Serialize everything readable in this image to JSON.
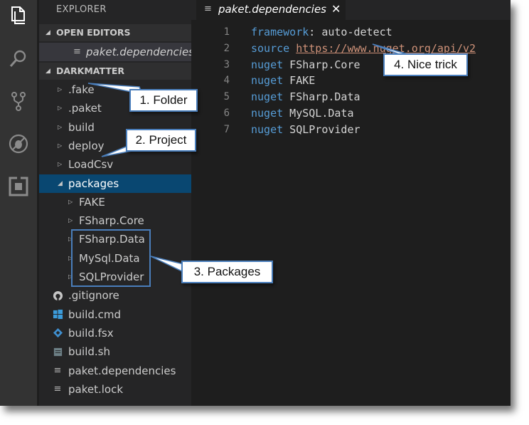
{
  "sidebar": {
    "title": "EXPLORER",
    "open_editors": {
      "header": "OPEN EDITORS",
      "items": [
        {
          "label": "paket.dependencies",
          "icon": "lines-icon"
        }
      ]
    },
    "project": {
      "header": "DARKMATTER",
      "items": [
        {
          "label": ".fake",
          "depth": 0,
          "state": "collapsed"
        },
        {
          "label": ".paket",
          "depth": 0,
          "state": "collapsed"
        },
        {
          "label": "build",
          "depth": 0,
          "state": "collapsed"
        },
        {
          "label": "deploy",
          "depth": 0,
          "state": "collapsed"
        },
        {
          "label": "LoadCsv",
          "depth": 0,
          "state": "collapsed"
        },
        {
          "label": "packages",
          "depth": 0,
          "state": "expanded"
        },
        {
          "label": "FAKE",
          "depth": 1,
          "state": "collapsed"
        },
        {
          "label": "FSharp.Core",
          "depth": 1,
          "state": "collapsed"
        },
        {
          "label": "FSharp.Data",
          "depth": 1,
          "state": "collapsed"
        },
        {
          "label": "MySql.Data",
          "depth": 1,
          "state": "collapsed"
        },
        {
          "label": "SQLProvider",
          "depth": 1,
          "state": "collapsed"
        },
        {
          "label": ".gitignore",
          "depth": 0,
          "icon": "github-icon"
        },
        {
          "label": "build.cmd",
          "depth": 0,
          "icon": "windows-icon"
        },
        {
          "label": "build.fsx",
          "depth": 0,
          "icon": "fsharp-icon"
        },
        {
          "label": "build.sh",
          "depth": 0,
          "icon": "shell-icon"
        },
        {
          "label": "paket.dependencies",
          "depth": 0,
          "icon": "lines-icon"
        },
        {
          "label": "paket.lock",
          "depth": 0,
          "icon": "lines-icon"
        }
      ]
    }
  },
  "tab": {
    "label": "paket.dependencies",
    "close": "✕"
  },
  "editor": {
    "lines": [
      {
        "num": "1",
        "kw": "framework",
        "rest": ": auto-detect"
      },
      {
        "num": "2",
        "kw": "source",
        "url": "https://www.nuget.org/api/v2"
      },
      {
        "num": "3",
        "kw": "nuget",
        "rest": " FSharp.Core"
      },
      {
        "num": "4",
        "kw": "nuget",
        "rest": " FAKE"
      },
      {
        "num": "5",
        "kw": "nuget",
        "rest": " FSharp.Data"
      },
      {
        "num": "6",
        "kw": "nuget",
        "rest": " MySQL.Data"
      },
      {
        "num": "7",
        "kw": "nuget",
        "rest": " SQLProvider"
      }
    ]
  },
  "callouts": {
    "folder": "1. Folder",
    "project": "2. Project",
    "packages": "3. Packages",
    "trick": "4. Nice trick"
  },
  "colors": {
    "accent": "#4a7ebb",
    "selection": "#094771",
    "keyword": "#569cd6",
    "url": "#ce9178"
  }
}
